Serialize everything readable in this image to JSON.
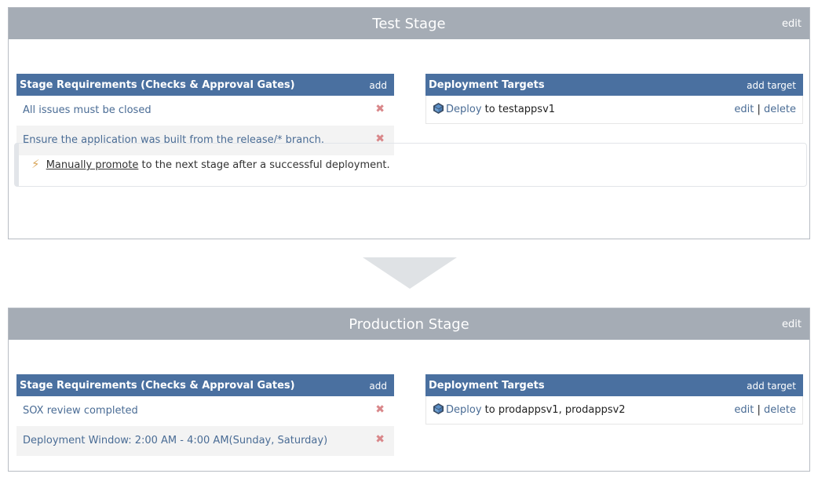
{
  "stages": [
    {
      "title": "Test Stage",
      "edit_label": "edit",
      "requirements": {
        "header": "Stage Requirements (Checks & Approval Gates)",
        "add_label": "add",
        "items": [
          {
            "text": "All issues must be closed",
            "remove_icon": "✖"
          },
          {
            "text": "Ensure the application was built from the release/* branch.",
            "remove_icon": "✖"
          }
        ]
      },
      "targets": {
        "header": "Deployment Targets",
        "add_label": "add target",
        "items": [
          {
            "deploy_label": "Deploy",
            "to_text": "to testappsv1",
            "edit_label": "edit",
            "sep": "|",
            "delete_label": "delete"
          }
        ]
      },
      "promotion": {
        "icon": "⚡",
        "link_label": "Manually promote",
        "text": "to the next stage after a successful deployment."
      }
    },
    {
      "title": "Production Stage",
      "edit_label": "edit",
      "requirements": {
        "header": "Stage Requirements (Checks & Approval Gates)",
        "add_label": "add",
        "items": [
          {
            "text": "SOX review completed",
            "remove_icon": "✖"
          },
          {
            "text": "Deployment Window: 2:00 AM - 4:00 AM(Sunday, Saturday)",
            "remove_icon": "✖"
          }
        ]
      },
      "targets": {
        "header": "Deployment Targets",
        "add_label": "add target",
        "items": [
          {
            "deploy_label": "Deploy",
            "to_text": "to prodappsv1, prodappsv2",
            "edit_label": "edit",
            "sep": "|",
            "delete_label": "delete"
          }
        ]
      }
    }
  ],
  "colors": {
    "stage_header": "#a5acb5",
    "panel_header": "#4a70a0",
    "link": "#4a6c95",
    "remove": "#d9878a",
    "arrow": "#dfe2e5"
  }
}
